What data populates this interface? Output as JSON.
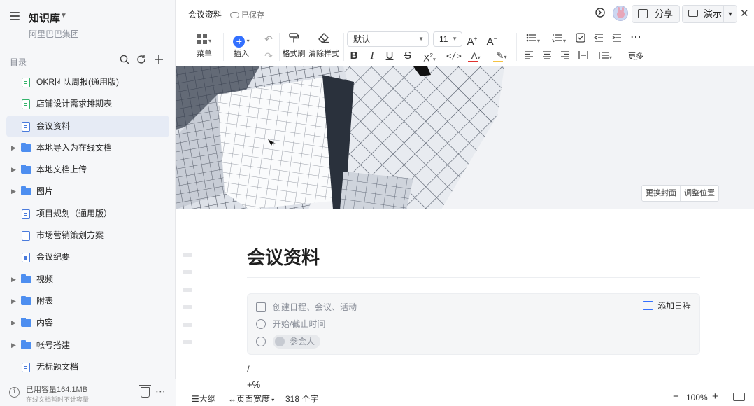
{
  "sidebar": {
    "kb_title": "知识库",
    "org": "阿里巴巴集团",
    "toc_label": "目录",
    "items": [
      {
        "label": "OKR团队周报(通用版)",
        "type": "doc-green"
      },
      {
        "label": "店铺设计需求排期表",
        "type": "doc-green"
      },
      {
        "label": "会议资料",
        "type": "doc",
        "active": true
      },
      {
        "label": "本地导入为在线文档",
        "type": "folder"
      },
      {
        "label": "本地文档上传",
        "type": "folder"
      },
      {
        "label": "图片",
        "type": "folder"
      },
      {
        "label": "项目规划（通用版）",
        "type": "doc"
      },
      {
        "label": "市场营销策划方案",
        "type": "doc"
      },
      {
        "label": "会议纪要",
        "type": "doc"
      },
      {
        "label": "视频",
        "type": "folder"
      },
      {
        "label": "附表",
        "type": "folder"
      },
      {
        "label": "内容",
        "type": "folder"
      },
      {
        "label": "帐号搭建",
        "type": "folder"
      },
      {
        "label": "无标题文档",
        "type": "doc"
      }
    ],
    "footer": {
      "capacity": "已用容量164.1MB",
      "note": "在线文档暂时不计容量"
    }
  },
  "header": {
    "doc_title": "会议资料",
    "saved": "已保存",
    "share_label": "分享",
    "present_label": "演示"
  },
  "toolbar": {
    "menu_label": "菜单",
    "insert_label": "插入",
    "format_painter_label": "格式刷",
    "clear_format_label": "清除样式",
    "style_value": "默认",
    "font_size_value": "11",
    "more_label": "更多",
    "text_color": "#e0312d",
    "highlight_color": "#f5c342"
  },
  "cover": {
    "change_cover": "更换封面",
    "adjust_position": "调整位置"
  },
  "document": {
    "title": "会议资料",
    "schedule": {
      "create_placeholder": "创建日程、会议、活动",
      "time_placeholder": "开始/截止时间",
      "participants_placeholder": "参会人",
      "add_label": "添加日程"
    },
    "lines": [
      "/",
      "+%"
    ]
  },
  "statusbar": {
    "outline": "大纲",
    "page_width": "页面宽度",
    "word_count": "318 个字",
    "zoom": "100%"
  }
}
